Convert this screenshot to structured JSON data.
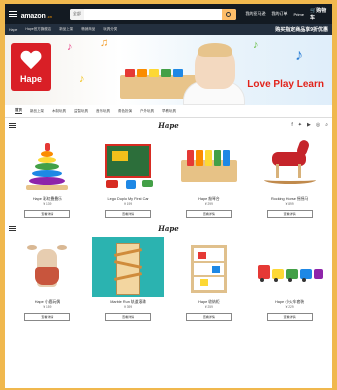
{
  "header": {
    "logo": "amazon",
    "logo_sub": ".cn",
    "search_category": "全部",
    "search_placeholder": "",
    "account_label": "我的亚马逊",
    "orders_label": "我的订单",
    "prime_label": "Prime",
    "cart_label": "购物车"
  },
  "subnav": {
    "items": [
      "Hape",
      "Hape官方旗舰店",
      "新品上架",
      "畅销商品",
      "玩具分类"
    ],
    "promo": "购买指定商品享9折优惠"
  },
  "banner": {
    "brand": "Hape",
    "tagline": "Love Play Learn"
  },
  "tabs": [
    "首页",
    "新品上架",
    "木制玩具",
    "益智玩具",
    "音乐玩具",
    "角色扮演",
    "户外玩具",
    "早教玩具"
  ],
  "section1": {
    "logo": "Hape"
  },
  "section2": {
    "logo": "Hape"
  },
  "social_icons": [
    "facebook-icon",
    "twitter-icon",
    "youtube-icon",
    "instagram-icon",
    "search-icon"
  ],
  "products_row1": [
    {
      "name": "Hape 彩虹叠叠乐",
      "price": "¥ 139",
      "button": "查看详情"
    },
    {
      "name": "Lego Duplo My First Car",
      "price": "¥ 199",
      "button": "查看详情"
    },
    {
      "name": "Hape 敲琴台",
      "price": "¥ 299",
      "button": "查看详情"
    },
    {
      "name": "Rocking Horse 摇摇马",
      "price": "¥ 899",
      "button": "查看详情"
    }
  ],
  "products_row2": [
    {
      "name": "Hape 小鹿玩偶",
      "price": "¥ 159",
      "button": "查看详情"
    },
    {
      "name": "Marble Run 轨道滚珠",
      "price": "¥ 399",
      "button": "查看详情"
    },
    {
      "name": "Hape 收纳柜",
      "price": "¥ 259",
      "button": "查看详情"
    },
    {
      "name": "Hape 小火车套装",
      "price": "¥ 229",
      "button": "查看详情"
    }
  ]
}
